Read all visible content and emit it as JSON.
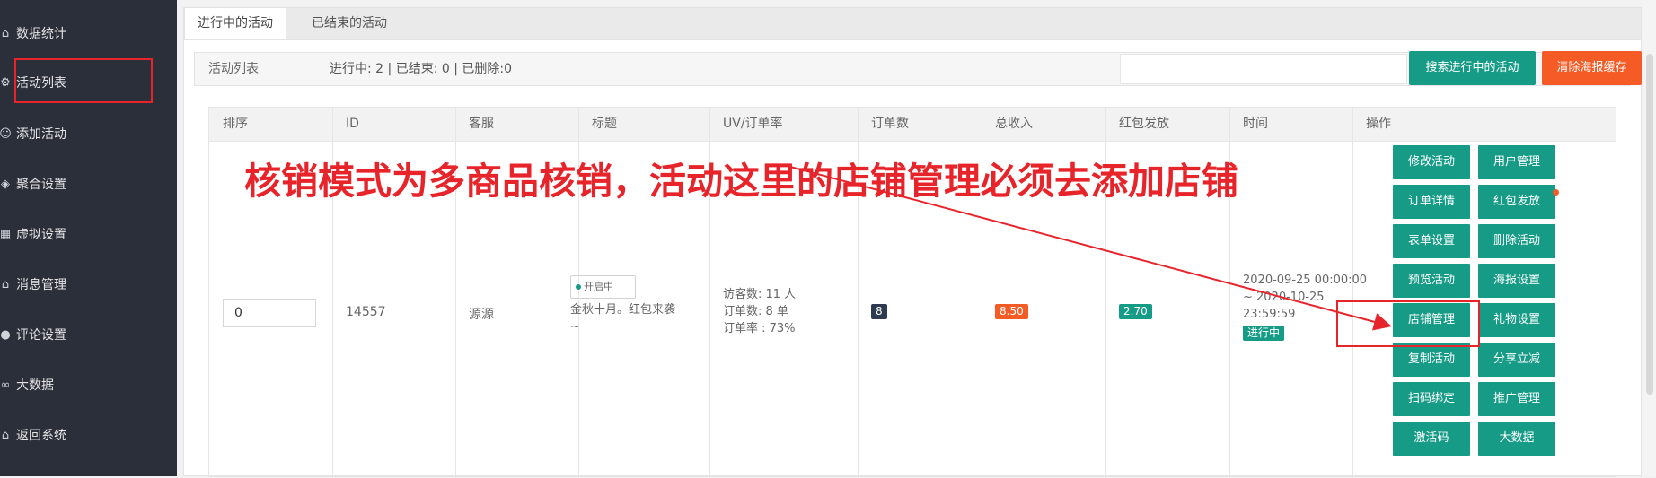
{
  "sidebar": {
    "items": [
      {
        "label": "数据统计",
        "icon": "home-icon"
      },
      {
        "label": "活动列表",
        "icon": "gear-icon"
      },
      {
        "label": "添加活动",
        "icon": "user-icon"
      },
      {
        "label": "聚合设置",
        "icon": "cube-icon"
      },
      {
        "label": "虚拟设置",
        "icon": "grid-icon"
      },
      {
        "label": "消息管理",
        "icon": "home-icon"
      },
      {
        "label": "评论设置",
        "icon": "chat-icon"
      },
      {
        "label": "大数据",
        "icon": "link-icon"
      },
      {
        "label": "返回系统",
        "icon": "home-icon"
      }
    ]
  },
  "tabs": [
    {
      "label": "进行中的活动",
      "active": true
    },
    {
      "label": "已结束的活动",
      "active": false
    }
  ],
  "panel": {
    "title": "活动列表",
    "stats": "进行中: 2 | 已结束: 0 | 已删除:0",
    "search_placeholder": "",
    "search_button": "搜索进行中的活动",
    "clear_button": "清除海报缓存"
  },
  "table": {
    "headers": [
      "排序",
      "ID",
      "客服",
      "标题",
      "UV/订单率",
      "订单数",
      "总收入",
      "红包发放",
      "时间",
      "操作"
    ],
    "row": {
      "order": "0",
      "id": "14557",
      "service": "源源",
      "status_chip": "开启中",
      "title": "金秋十月。红包来袭~",
      "uv": [
        "访客数: 11 人",
        "订单数: 8 单",
        "订单率 : 73%"
      ],
      "orders": "8",
      "income": "8.50",
      "redpacket": "2.70",
      "time_range": "2020-09-25 00:00:00 ~ 2020-10-25 23:59:59",
      "time_status": "进行中",
      "actions": [
        [
          "修改活动",
          "用户管理"
        ],
        [
          "订单详情",
          "红包发放"
        ],
        [
          "表单设置",
          "删除活动"
        ],
        [
          "预览活动",
          "海报设置"
        ],
        [
          "店铺管理",
          "礼物设置"
        ],
        [
          "复制活动",
          "分享立减"
        ],
        [
          "扫码绑定",
          "推广管理"
        ],
        [
          "激活码",
          "大数据"
        ]
      ]
    }
  },
  "annotation": "核销模式为多商品核销，活动这里的店铺管理必须去添加店铺",
  "colors": {
    "sidebar_bg": "#2b2f3a",
    "primary": "#169b86",
    "orange": "#f55b25",
    "annotation_red": "#e8242b",
    "badge_dark": "#2e3a4f"
  }
}
